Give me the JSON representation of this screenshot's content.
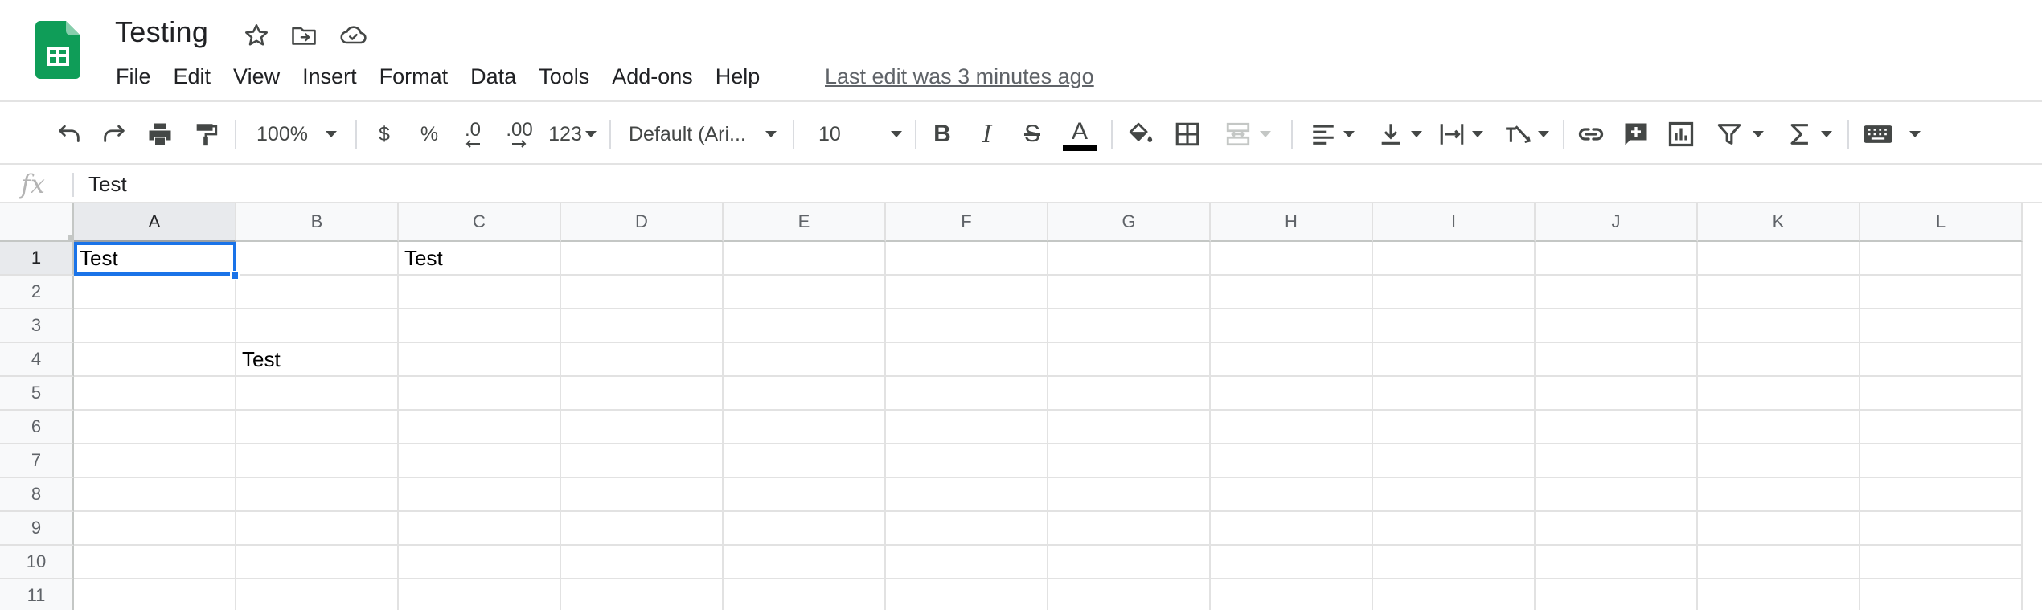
{
  "header": {
    "title": "Testing",
    "last_edit": "Last edit was 3 minutes ago",
    "menu": [
      "File",
      "Edit",
      "View",
      "Insert",
      "Format",
      "Data",
      "Tools",
      "Add-ons",
      "Help"
    ]
  },
  "toolbar": {
    "zoom": "100%",
    "currency": "$",
    "percent": "%",
    "decrease_decimal": ".0",
    "increase_decimal": ".00",
    "number_format": "123",
    "font_family": "Default (Ari...",
    "font_size": "10",
    "bold": "B",
    "italic": "I",
    "strikethrough": "S",
    "text_color": "A",
    "text_color_value": "#000000"
  },
  "formula_bar": {
    "fx": "fx",
    "value": "Test"
  },
  "grid": {
    "columns": [
      "A",
      "B",
      "C",
      "D",
      "E",
      "F",
      "G",
      "H",
      "I",
      "J",
      "K",
      "L"
    ],
    "rows": [
      "1",
      "2",
      "3",
      "4",
      "5",
      "6",
      "7",
      "8",
      "9",
      "10",
      "11"
    ],
    "cells": [
      [
        "Test",
        "",
        "Test",
        "",
        "",
        "",
        "",
        "",
        "",
        "",
        "",
        ""
      ],
      [
        "",
        "",
        "",
        "",
        "",
        "",
        "",
        "",
        "",
        "",
        "",
        ""
      ],
      [
        "",
        "",
        "",
        "",
        "",
        "",
        "",
        "",
        "",
        "",
        "",
        ""
      ],
      [
        "",
        "Test",
        "",
        "",
        "",
        "",
        "",
        "",
        "",
        "",
        "",
        ""
      ],
      [
        "",
        "",
        "",
        "",
        "",
        "",
        "",
        "",
        "",
        "",
        "",
        ""
      ],
      [
        "",
        "",
        "",
        "",
        "",
        "",
        "",
        "",
        "",
        "",
        "",
        ""
      ],
      [
        "",
        "",
        "",
        "",
        "",
        "",
        "",
        "",
        "",
        "",
        "",
        ""
      ],
      [
        "",
        "",
        "",
        "",
        "",
        "",
        "",
        "",
        "",
        "",
        "",
        ""
      ],
      [
        "",
        "",
        "",
        "",
        "",
        "",
        "",
        "",
        "",
        "",
        "",
        ""
      ],
      [
        "",
        "",
        "",
        "",
        "",
        "",
        "",
        "",
        "",
        "",
        "",
        ""
      ],
      [
        "",
        "",
        "",
        "",
        "",
        "",
        "",
        "",
        "",
        "",
        "",
        ""
      ]
    ],
    "selected_cell": "A1"
  },
  "colors": {
    "accent": "#1a73e8",
    "sheets_green": "#0f9d58"
  }
}
